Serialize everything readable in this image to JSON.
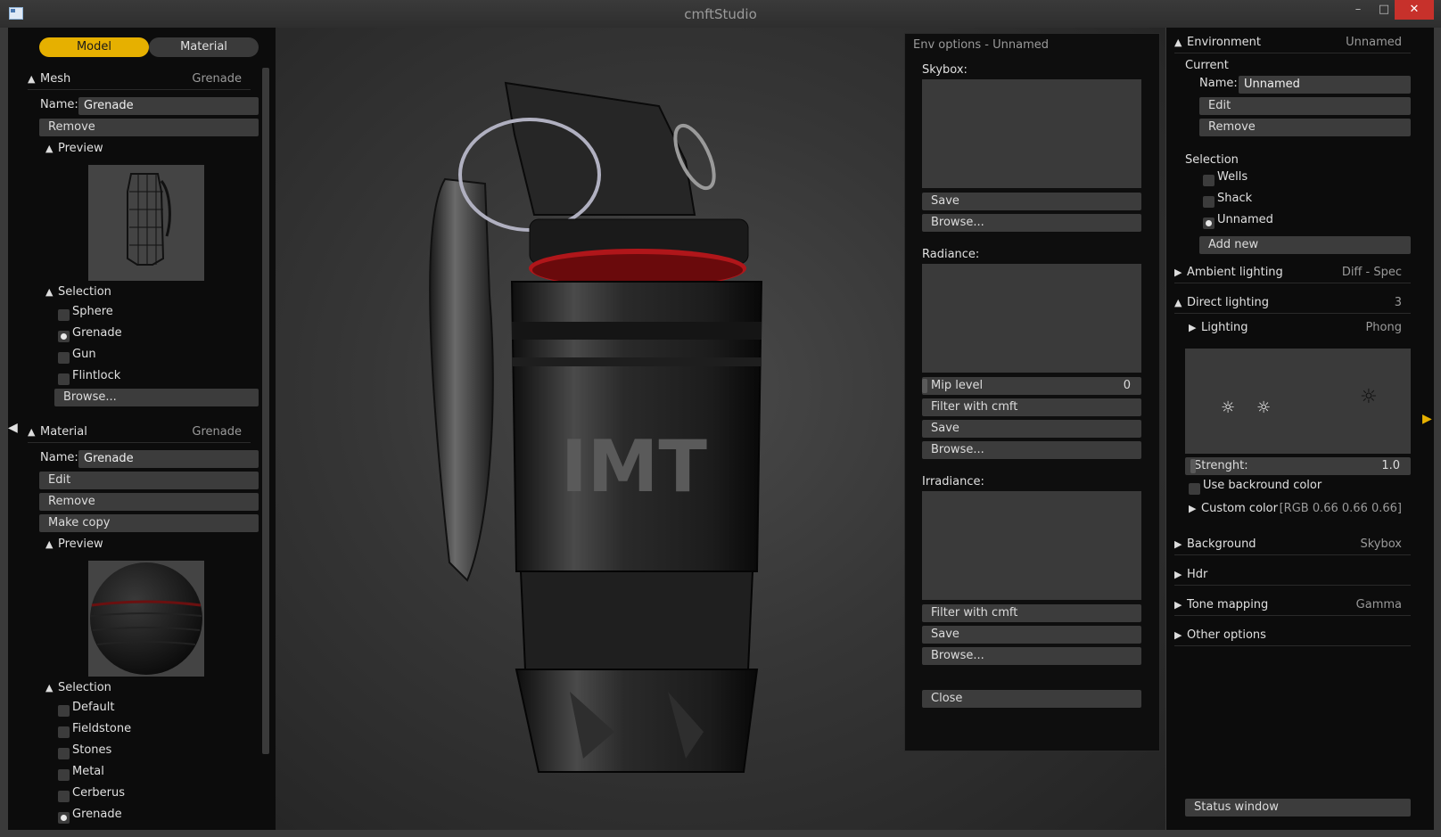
{
  "window": {
    "title": "cmftStudio",
    "minimize": "–",
    "maximize": "□",
    "close": "✕"
  },
  "left": {
    "tabs": [
      "Model",
      "Material"
    ],
    "mesh": {
      "header": "Mesh",
      "header_value": "Grenade",
      "name_label": "Name:",
      "name_value": "Grenade",
      "remove": "Remove",
      "preview_label": "Preview",
      "selection_label": "Selection",
      "items": [
        "Sphere",
        "Grenade",
        "Gun",
        "Flintlock"
      ],
      "selected_index": 1,
      "browse": "Browse..."
    },
    "material": {
      "header": "Material",
      "header_value": "Grenade",
      "name_label": "Name:",
      "name_value": "Grenade",
      "edit": "Edit",
      "remove": "Remove",
      "make_copy": "Make copy",
      "preview_label": "Preview",
      "selection_label": "Selection",
      "items": [
        "Default",
        "Fieldstone",
        "Stones",
        "Metal",
        "Cerberus",
        "Grenade"
      ],
      "selected_index": 5
    }
  },
  "env_dialog": {
    "title": "Env options - Unnamed",
    "skybox_label": "Skybox:",
    "skybox_save": "Save",
    "skybox_browse": "Browse...",
    "radiance_label": "Radiance:",
    "mip_label": "Mip level",
    "mip_value": "0",
    "radiance_filter": "Filter with cmft",
    "radiance_save": "Save",
    "radiance_browse": "Browse...",
    "irradiance_label": "Irradiance:",
    "irradiance_filter": "Filter with cmft",
    "irradiance_save": "Save",
    "irradiance_browse": "Browse...",
    "close": "Close"
  },
  "right": {
    "environment": {
      "header": "Environment",
      "value": "Unnamed"
    },
    "current_label": "Current",
    "name_label": "Name:",
    "name_value": "Unnamed",
    "edit": "Edit",
    "remove": "Remove",
    "selection_label": "Selection",
    "items": [
      "Wells",
      "Shack",
      "Unnamed"
    ],
    "selected_index": 2,
    "add_new": "Add new",
    "ambient": {
      "label": "Ambient lighting",
      "value": "Diff - Spec"
    },
    "direct": {
      "label": "Direct lighting",
      "value": "3"
    },
    "lighting": {
      "label": "Lighting",
      "value": "Phong"
    },
    "strength_label": "Strenght:",
    "strength_value": "1.0",
    "use_bg_color": "Use backround color",
    "custom_color": {
      "label": "Custom color",
      "value": "[RGB 0.66 0.66 0.66]"
    },
    "background": {
      "label": "Background",
      "value": "Skybox"
    },
    "hdr": {
      "label": "Hdr"
    },
    "tone_mapping": {
      "label": "Tone mapping",
      "value": "Gamma"
    },
    "other_options": {
      "label": "Other options"
    },
    "status_window": "Status window"
  },
  "colors": {
    "accent": "#e6b000",
    "panel": "#0c0c0c",
    "field": "#3c3c3c",
    "grenade_band": "#b0161a",
    "close_button": "#c7312b"
  }
}
